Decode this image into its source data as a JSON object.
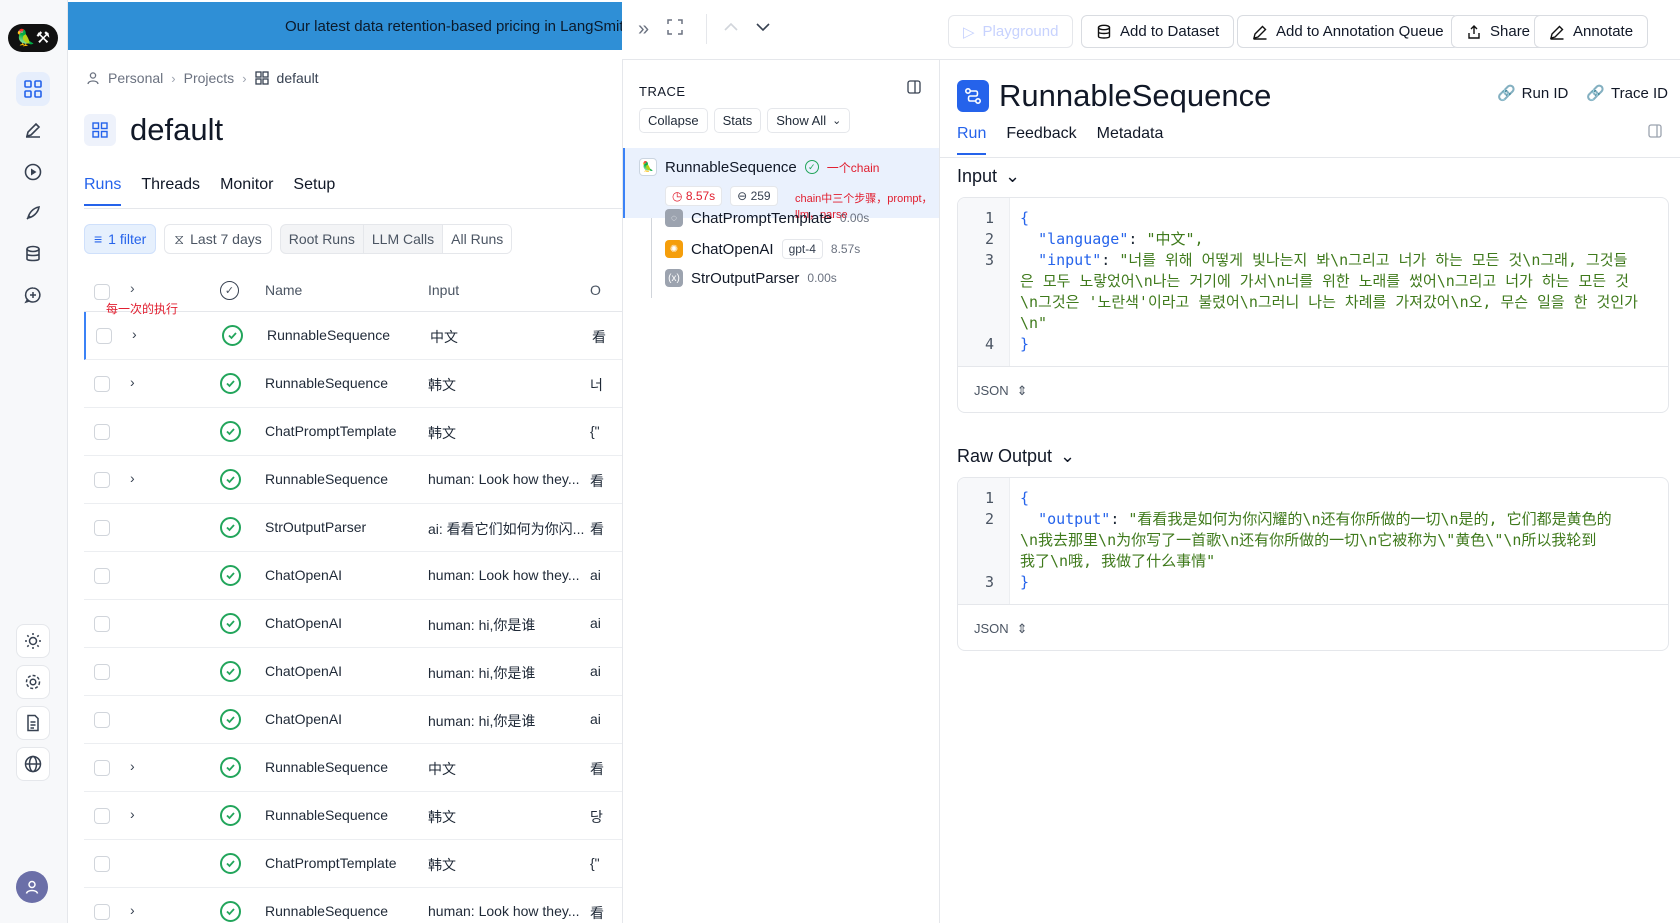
{
  "banner": {
    "text": "Our latest data retention-based pricing in LangSmith"
  },
  "breadcrumb": {
    "personal": "Personal",
    "projects": "Projects",
    "current": "default"
  },
  "project": {
    "title": "default"
  },
  "tabs": [
    "Runs",
    "Threads",
    "Monitor",
    "Setup"
  ],
  "filters": {
    "filter": "1 filter",
    "range": "Last 7 days",
    "seg": [
      "Root Runs",
      "LLM Calls",
      "All Runs"
    ]
  },
  "table": {
    "columns": {
      "name": "Name",
      "input": "Input",
      "output": "O"
    },
    "annotation": "每一次的执行",
    "rows": [
      {
        "name": "RunnableSequence",
        "input": "中文",
        "output": "看",
        "expand": true
      },
      {
        "name": "RunnableSequence",
        "input": "韩文",
        "output": "너",
        "expand": true
      },
      {
        "name": "ChatPromptTemplate",
        "input": "韩文",
        "output": "{\"",
        "expand": false
      },
      {
        "name": "RunnableSequence",
        "input": "human: Look how they...",
        "output": "看",
        "expand": true
      },
      {
        "name": "StrOutputParser",
        "input": "ai: 看看它们如何为你闪...",
        "output": "看",
        "expand": false
      },
      {
        "name": "ChatOpenAI",
        "input": "human: Look how they...",
        "output": "ai",
        "expand": false
      },
      {
        "name": "ChatOpenAI",
        "input": "human: hi,你是谁",
        "output": "ai",
        "expand": false
      },
      {
        "name": "ChatOpenAI",
        "input": "human: hi,你是谁",
        "output": "ai",
        "expand": false
      },
      {
        "name": "ChatOpenAI",
        "input": "human: hi,你是谁",
        "output": "ai",
        "expand": false
      },
      {
        "name": "RunnableSequence",
        "input": "中文",
        "output": "看",
        "expand": true
      },
      {
        "name": "RunnableSequence",
        "input": "韩文",
        "output": "당",
        "expand": true
      },
      {
        "name": "ChatPromptTemplate",
        "input": "韩文",
        "output": "{\"",
        "expand": false
      },
      {
        "name": "RunnableSequence",
        "input": "human: Look how they...",
        "output": "看",
        "expand": true
      }
    ]
  },
  "toolbar": {
    "playground": "Playground",
    "dataset": "Add to Dataset",
    "queue": "Add to Annotation Queue",
    "share": "Share",
    "annotate": "Annotate"
  },
  "trace": {
    "heading": "TRACE",
    "buttons": [
      "Collapse",
      "Stats",
      "Show All"
    ],
    "root": {
      "name": "RunnableSequence",
      "time": "8.57s",
      "tokens": "259",
      "note": "一个chain"
    },
    "note2": "chain中三个步骤，prompt，llm，parse",
    "children": [
      {
        "name": "ChatPromptTemplate",
        "time": "0.00s",
        "tag": ""
      },
      {
        "name": "ChatOpenAI",
        "time": "8.57s",
        "tag": "gpt-4"
      },
      {
        "name": "StrOutputParser",
        "time": "0.00s",
        "tag": ""
      }
    ]
  },
  "detail": {
    "title": "RunnableSequence",
    "run_id": "Run ID",
    "trace_id": "Trace ID",
    "tabs": [
      "Run",
      "Feedback",
      "Metadata"
    ],
    "input_label": "Input",
    "output_label": "Raw Output",
    "input_lines": {
      "l1": "{",
      "k_lang": "\"language\"",
      "v_lang": "\"中文\",",
      "k_input": "\"input\"",
      "v_input_1": "\"너를 위해 어떻게 빛나는지 봐\\n그리고 너가 하는 모든 것\\n그래, 그것들",
      "v_input_2": "은 모두 노랗었어\\n나는 거기에 가서\\n너를 위한 노래를 썼어\\n그리고 너가 하는 모든 것",
      "v_input_3": "\\n그것은 '노란색'이라고 불렸어\\n그러니 나는 차례를 가져갔어\\n오, 무슨 일을 한 것인가",
      "v_input_4": "\\n\"",
      "l4": "}"
    },
    "output_lines": {
      "l1": "{",
      "k_out": "\"output\"",
      "v_out_1": "\"看看我是如何为你闪耀的\\n还有你所做的一切\\n是的, 它们都是黄色的",
      "v_out_2": "\\n我去那里\\n为你写了一首歌\\n还有你所做的一切\\n它被称为\\\"黄色\\\"\\n所以我轮到",
      "v_out_3": "我了\\n哦, 我做了什么事情\"",
      "l3": "}"
    },
    "format": "JSON"
  }
}
